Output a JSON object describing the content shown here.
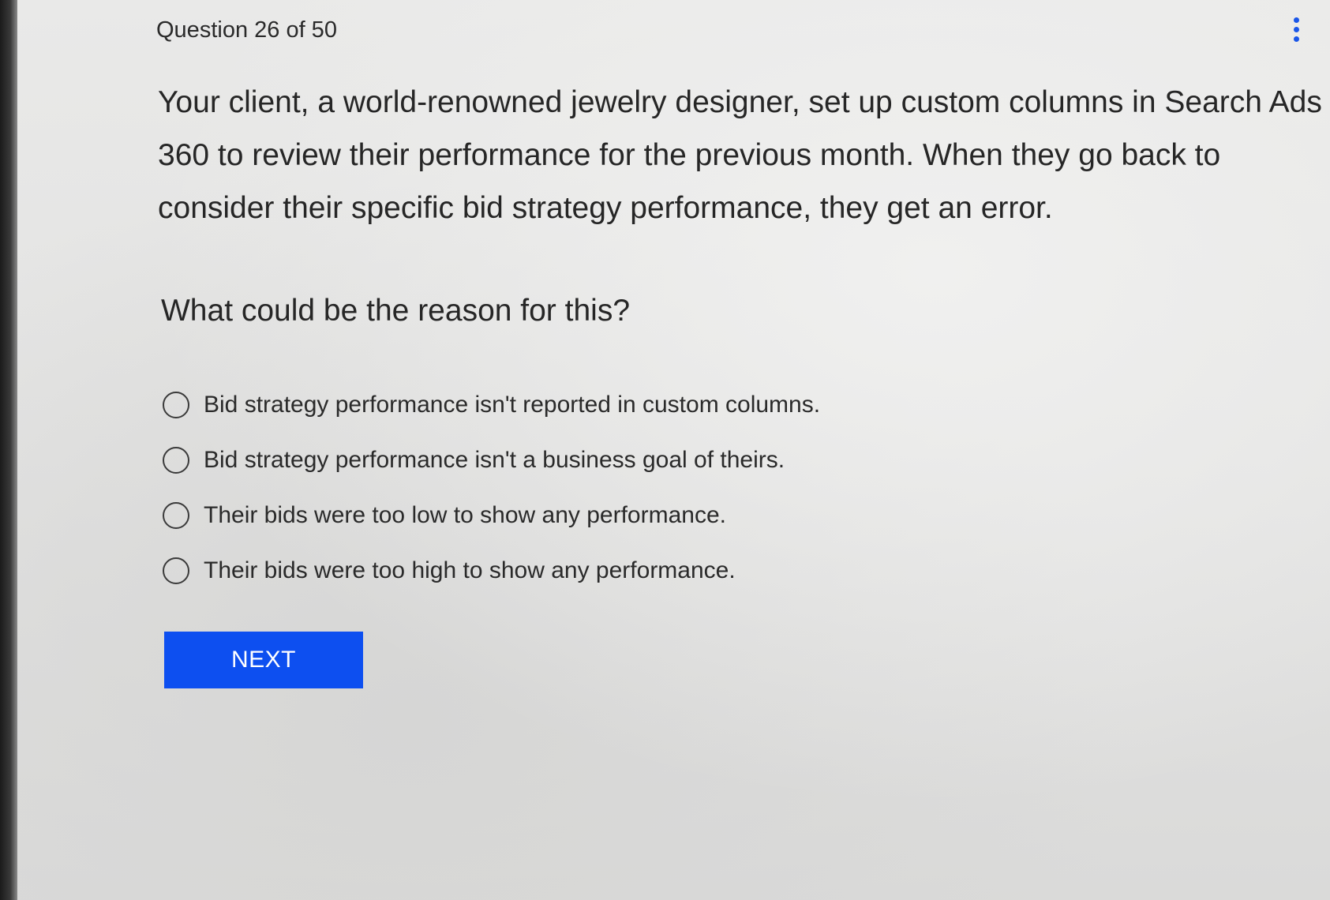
{
  "header": {
    "counter": "Question 26 of 50"
  },
  "question": {
    "text": "Your client, a world-renowned jewelry designer, set up custom columns in Search Ads 360 to review their performance for the previous month. When they go back to consider their specific bid strategy performance, they get an error.",
    "prompt": "What could be the reason for this?"
  },
  "options": [
    {
      "label": "Bid strategy performance isn't reported in custom columns."
    },
    {
      "label": "Bid strategy performance isn't a business goal of theirs."
    },
    {
      "label": "Their bids were too low to show any performance."
    },
    {
      "label": "Their bids were too high to show any performance."
    }
  ],
  "footer": {
    "next_label": "NEXT"
  },
  "colors": {
    "accent": "#0d4ff0",
    "menu_icon": "#1a56e8"
  },
  "icons": {
    "menu": "more-vertical-icon",
    "radio": "radio-unchecked-icon"
  }
}
